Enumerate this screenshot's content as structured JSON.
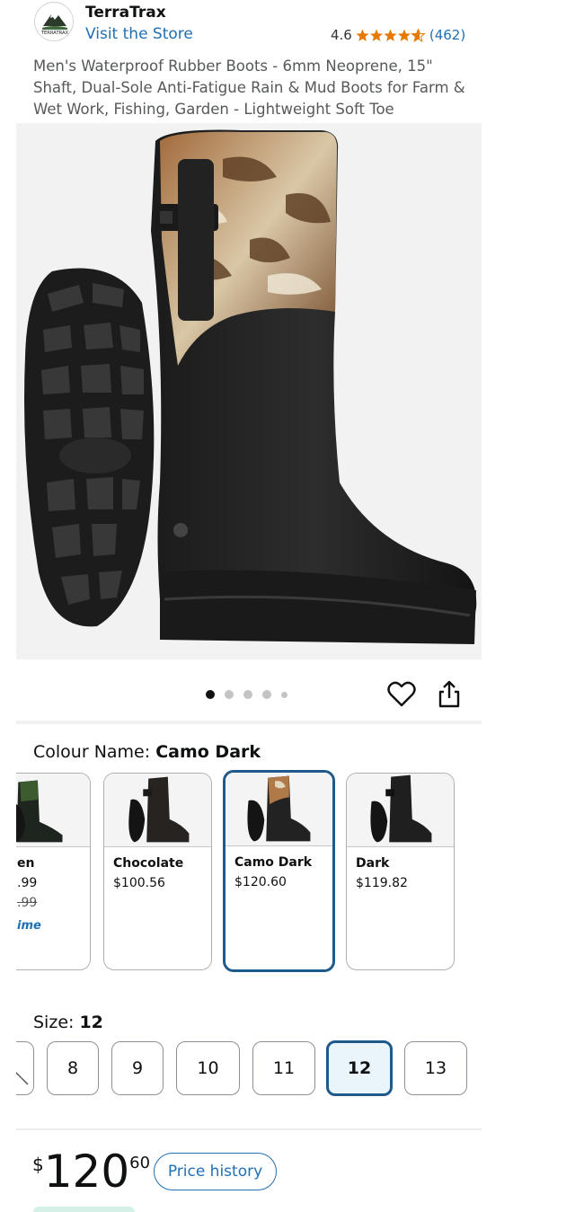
{
  "store": {
    "brand_name": "TerraTrax",
    "logo_text": "TERRATRAX",
    "visit_link": "Visit the Store",
    "rating": "4.6",
    "rating_count": "(462)",
    "star_color": "#e67a00"
  },
  "product": {
    "title": "Men's Waterproof Rubber Boots - 6mm Neoprene, 15\" Shaft, Dual-Sole Anti-Fatigue Rain & Mud Boots for Farm & Wet Work, Fishing, Garden - Lightweight Soft Toe",
    "image_count": 5,
    "active_image": 1
  },
  "colour": {
    "label": "Colour Name: ",
    "selected": "Camo Dark",
    "swatches": [
      {
        "name": "en",
        "price": ".99",
        "old_price": ".99",
        "badge": "ime"
      },
      {
        "name": "Chocolate",
        "price": "$100.56"
      },
      {
        "name": "Camo Dark",
        "price": "$120.60"
      },
      {
        "name": "Dark",
        "price": "$119.82"
      }
    ]
  },
  "size": {
    "label": "Size: ",
    "selected": "12",
    "options": [
      "8",
      "9",
      "10",
      "11",
      "12",
      "13"
    ]
  },
  "price": {
    "symbol": "$",
    "whole": "120",
    "fraction": "60",
    "history_button": "Price history"
  },
  "colors": {
    "link_blue": "#1f6fb5",
    "selected_border": "#1e5a8c"
  }
}
